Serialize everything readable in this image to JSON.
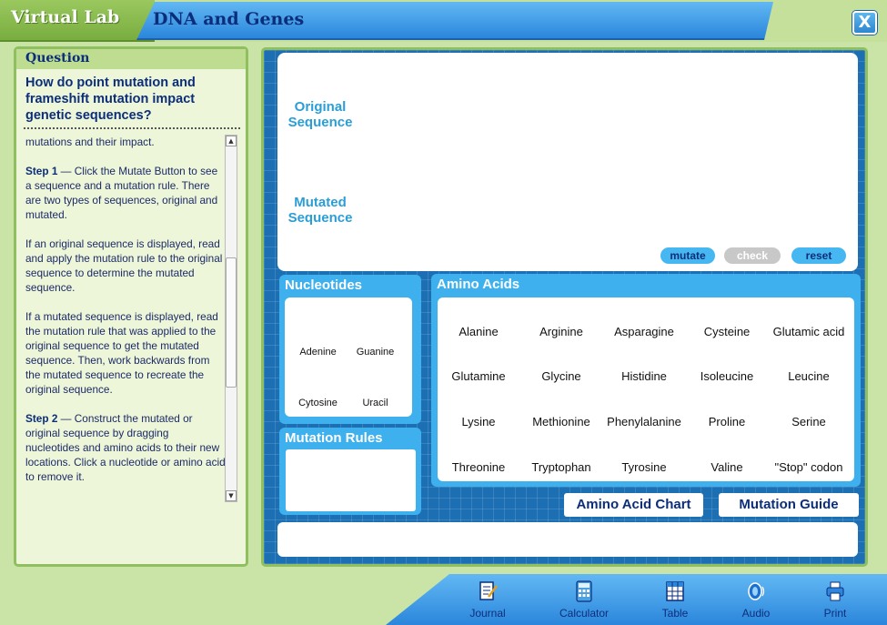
{
  "app": {
    "name": "Virtual Lab",
    "module": "DNA and Genes",
    "close_label": "X"
  },
  "question": {
    "header": "Question",
    "text": "How do point mutation and frameshift mutation impact genetic sequences?"
  },
  "instructions": {
    "intro": "mutations and their impact.",
    "step1_label": "Step 1",
    "step1_text": " — Click the Mutate Button to see a sequence and a mutation rule. There are two types of sequences, original and mutated.",
    "para2": "If an original sequence is displayed, read and apply the mutation rule to the original sequence to determine the mutated sequence.",
    "para3": "If a mutated sequence is displayed, read the mutation rule that was applied to the original sequence to get the mutated sequence. Then, work backwards from the mutated sequence to recreate the original sequence.",
    "step2_label": "Step 2",
    "step2_text": " — Construct the mutated or original sequence by dragging nucleotides and amino acids to their new locations. Click a nucleotide or amino acid to remove it."
  },
  "sequences": {
    "original_line1": "Original",
    "original_line2": "Sequence",
    "mutated_line1": "Mutated",
    "mutated_line2": "Sequence"
  },
  "controls": {
    "mutate": "mutate",
    "check": "check",
    "reset": "reset"
  },
  "nucleotides": {
    "title": "Nucleotides",
    "items": [
      "Adenine",
      "Guanine",
      "Cytosine",
      "Uracil"
    ]
  },
  "mutation_rules": {
    "title": "Mutation Rules"
  },
  "amino_acids": {
    "title": "Amino Acids",
    "rows": [
      [
        "Alanine",
        "Arginine",
        "Asparagine",
        "Cysteine",
        "Glutamic acid"
      ],
      [
        "Glutamine",
        "Glycine",
        "Histidine",
        "Isoleucine",
        "Leucine"
      ],
      [
        "Lysine",
        "Methionine",
        "Phenylalanine",
        "Proline",
        "Serine"
      ],
      [
        "Threonine",
        "Tryptophan",
        "Tyrosine",
        "Valine",
        "\"Stop\" codon"
      ]
    ]
  },
  "buttons": {
    "amino_acid_chart": "Amino Acid Chart",
    "mutation_guide": "Mutation Guide"
  },
  "toolbar": {
    "journal": "Journal",
    "calculator": "Calculator",
    "table": "Table",
    "audio": "Audio",
    "print": "Print"
  }
}
